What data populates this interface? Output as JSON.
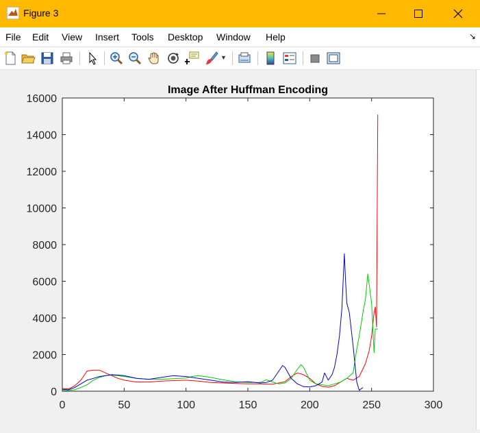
{
  "window": {
    "title": "Figure 3",
    "title_bar_color": "#ffb900"
  },
  "menu": {
    "items": [
      "File",
      "Edit",
      "View",
      "Insert",
      "Tools",
      "Desktop",
      "Window",
      "Help"
    ]
  },
  "toolbar": {
    "icons": [
      "new-figure-icon",
      "open-file-icon",
      "save-icon",
      "print-icon",
      "pointer-icon",
      "zoom-in-icon",
      "zoom-out-icon",
      "pan-hand-icon",
      "rotate-3d-icon",
      "data-cursor-icon",
      "brush-icon",
      "brush-dropdown-icon",
      "link-plot-icon",
      "colorbar-icon",
      "legend-icon",
      "hide-plot-tools-icon",
      "show-plot-tools-icon"
    ]
  },
  "chart_data": {
    "type": "line",
    "title": "Image After Huffman Encoding",
    "xlabel": "",
    "ylabel": "",
    "xlim": [
      0,
      300
    ],
    "ylim": [
      0,
      16000
    ],
    "xticks": [
      0,
      50,
      100,
      150,
      200,
      250,
      300
    ],
    "yticks": [
      0,
      2000,
      4000,
      6000,
      8000,
      10000,
      12000,
      14000,
      16000
    ],
    "grid": false,
    "series": [
      {
        "color": "#ff0000",
        "x": [
          0,
          5,
          10,
          15,
          20,
          25,
          30,
          35,
          40,
          45,
          50,
          55,
          60,
          70,
          80,
          90,
          100,
          110,
          120,
          130,
          140,
          150,
          160,
          170,
          180,
          185,
          190,
          195,
          200,
          205,
          210,
          215,
          220,
          225,
          230,
          235,
          240,
          245,
          248,
          250,
          252,
          253,
          254,
          255
        ],
        "y": [
          150,
          120,
          300,
          600,
          1100,
          1150,
          1150,
          1000,
          850,
          700,
          600,
          550,
          500,
          500,
          550,
          580,
          600,
          550,
          480,
          450,
          420,
          400,
          400,
          380,
          520,
          800,
          1000,
          900,
          700,
          400,
          260,
          220,
          300,
          500,
          700,
          600,
          800,
          1500,
          2200,
          3000,
          4300,
          4600,
          3500,
          15100
        ]
      },
      {
        "color": "#00cc00",
        "x": [
          0,
          5,
          10,
          15,
          20,
          25,
          30,
          35,
          40,
          45,
          50,
          55,
          60,
          70,
          80,
          90,
          100,
          105,
          110,
          120,
          130,
          140,
          150,
          160,
          165,
          170,
          175,
          180,
          185,
          190,
          193,
          195,
          200,
          205,
          210,
          215,
          220,
          225,
          230,
          235,
          238,
          240,
          243,
          245,
          247,
          250,
          252,
          253,
          255
        ],
        "y": [
          50,
          40,
          80,
          200,
          350,
          600,
          750,
          850,
          880,
          850,
          800,
          750,
          700,
          650,
          650,
          680,
          720,
          800,
          850,
          750,
          620,
          520,
          480,
          480,
          620,
          500,
          400,
          450,
          700,
          1200,
          1450,
          1300,
          600,
          400,
          350,
          300,
          400,
          500,
          700,
          1000,
          2300,
          3000,
          4300,
          5000,
          6400,
          4800,
          2100,
          3400,
          3400
        ]
      },
      {
        "color": "#0000cc",
        "x": [
          0,
          5,
          10,
          15,
          20,
          25,
          30,
          35,
          40,
          45,
          50,
          60,
          70,
          80,
          90,
          100,
          110,
          120,
          130,
          140,
          150,
          160,
          165,
          170,
          175,
          178,
          180,
          185,
          190,
          195,
          200,
          205,
          210,
          212,
          215,
          218,
          220,
          222,
          224,
          226,
          228,
          229,
          230,
          232,
          235,
          238,
          240,
          243
        ],
        "y": [
          100,
          80,
          200,
          400,
          600,
          700,
          800,
          850,
          900,
          880,
          850,
          700,
          650,
          750,
          850,
          800,
          700,
          600,
          500,
          480,
          520,
          450,
          480,
          600,
          1100,
          1400,
          1300,
          700,
          400,
          250,
          230,
          300,
          500,
          1000,
          600,
          900,
          1300,
          2000,
          3000,
          4500,
          7500,
          6000,
          4800,
          4300,
          2500,
          500,
          50,
          200
        ]
      }
    ]
  }
}
